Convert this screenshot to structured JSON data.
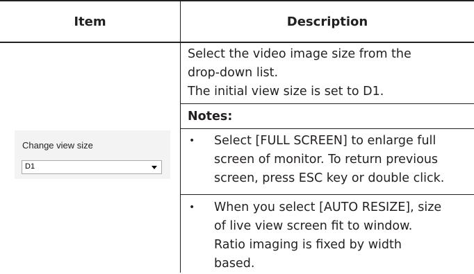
{
  "table": {
    "headers": {
      "item": "Item",
      "description": "Description"
    }
  },
  "widget": {
    "label": "Change view size",
    "select": {
      "selected": "D1"
    }
  },
  "description": {
    "lines": [
      "Select the video image size from the",
      "drop-down list.",
      "The initial view size is set to D1."
    ],
    "notes_label": "Notes:",
    "bullet_char": "•",
    "notes": [
      {
        "lines": [
          "Select [FULL SCREEN] to enlarge full",
          "screen of monitor. To return previous",
          "screen, press ESC key or double click."
        ]
      },
      {
        "lines": [
          "When you select [AUTO RESIZE], size",
          "of live view screen fit to window.",
          "Ratio imaging is fixed by width",
          "based."
        ]
      }
    ]
  }
}
